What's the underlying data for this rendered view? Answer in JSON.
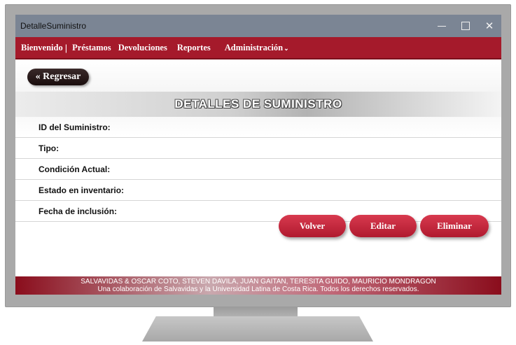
{
  "window": {
    "title": "DetalleSuministro"
  },
  "nav": {
    "items": [
      "Bienvenido",
      "Préstamos",
      "Devoluciones",
      "Reportes",
      "Administración"
    ],
    "separator": "|"
  },
  "back_button": "« Regresar",
  "header": {
    "title": "DETALLES DE SUMINISTRO"
  },
  "details": [
    {
      "label": "ID del Suministro:",
      "value": ""
    },
    {
      "label": "Tipo:",
      "value": ""
    },
    {
      "label": "Condición Actual:",
      "value": ""
    },
    {
      "label": "Estado en inventario:",
      "value": ""
    },
    {
      "label": "Fecha de inclusión:",
      "value": ""
    }
  ],
  "actions": {
    "volver": "Volver",
    "editar": "Editar",
    "eliminar": "Eliminar"
  },
  "footer": {
    "line1": "SALVAVIDAS & OSCAR COTO, STEVEN DAVILA, JUAN GAITAN, TERESITA GUIDO, MAURICIO MONDRAGON",
    "line2": "Una colaboración de Salvavidas y la Universidad Latina de Costa Rica. Todos los derechos reservados."
  },
  "colors": {
    "accent": "#a51a2b",
    "button": "#c92a40",
    "titlebar": "#7b8594"
  }
}
